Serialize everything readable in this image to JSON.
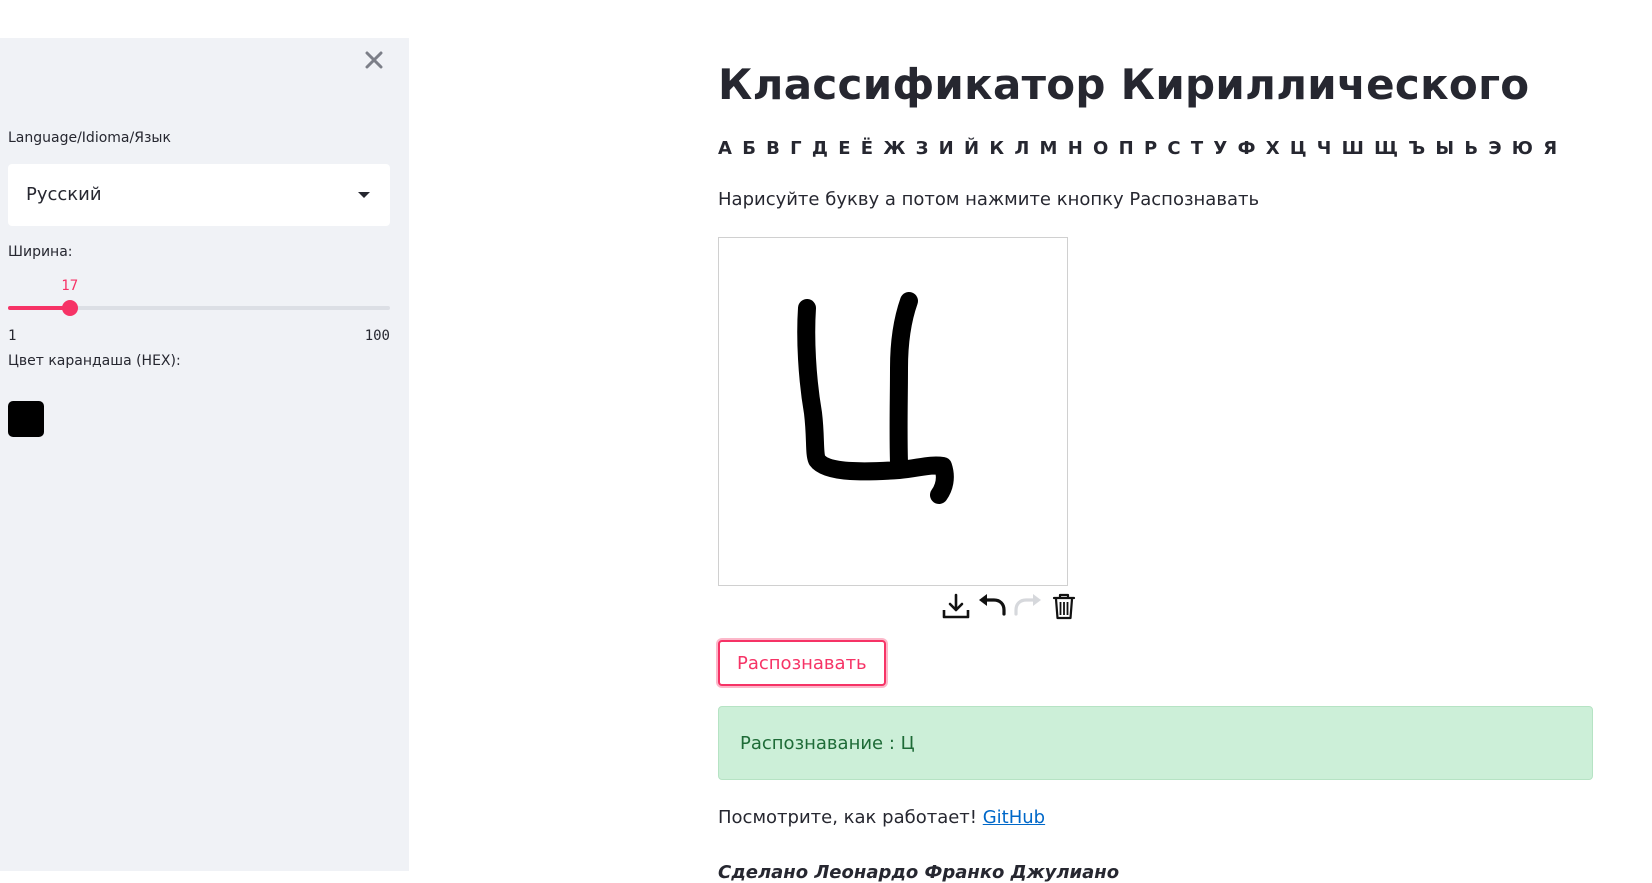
{
  "sidebar": {
    "close_icon": "close-icon",
    "language_label": "Language/Idioma/Язык",
    "language_selected": "Русский",
    "width_label": "Ширина:",
    "width_slider": {
      "value": 17,
      "min": 1,
      "max": 100,
      "value_text": "17",
      "min_text": "1",
      "max_text": "100"
    },
    "pencil_color_label": "Цвет карандаша (HEX):",
    "pencil_color": "#000000"
  },
  "main": {
    "title": "Классификатор Кириллического",
    "alphabet": "А Б В Г Д Е Ё Ж З И Й К Л М Н О П Р С Т У Ф Х Ц Ч Ш Щ Ъ Ы Ь Э Ю Я",
    "instructions": "Нарисуйте букву а потом нажмите кнопку Распознавать",
    "canvas_toolbar": {
      "download_icon": "download-icon",
      "undo_icon": "undo-icon",
      "redo_icon": "redo-icon",
      "trash_icon": "trash-icon"
    },
    "recognize_button": "Распознавать",
    "result_text": "Распознавание : Ц",
    "footer_text": "Посмотрите, как работает! ",
    "footer_link": "GitHub",
    "credits": "Сделано Леонардо Франко Джулиано"
  },
  "colors": {
    "accent": "#f63366",
    "sidebar_bg": "#f0f2f6",
    "success_bg": "#ccefd8",
    "success_text": "#1e6b37",
    "link": "#0068c9"
  }
}
